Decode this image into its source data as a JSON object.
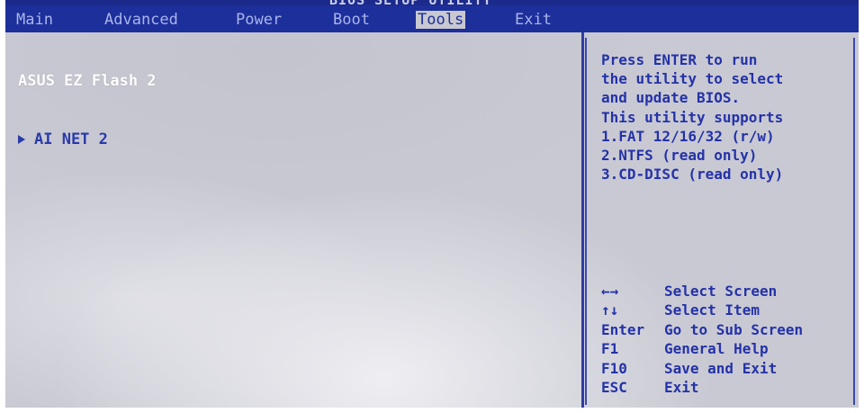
{
  "title": "BIOS SETUP UTILITY",
  "menu": [
    {
      "label": "Main"
    },
    {
      "label": "Advanced"
    },
    {
      "label": "Power"
    },
    {
      "label": "Boot"
    },
    {
      "label": "Tools"
    },
    {
      "label": "Exit"
    }
  ],
  "active_tab": "Tools",
  "left_panel": {
    "items": [
      {
        "label": "ASUS EZ Flash 2"
      },
      {
        "label": "AI NET 2",
        "icon": "right-triangle-icon"
      }
    ]
  },
  "help_panel": {
    "lines": [
      "Press ENTER to run",
      "the utility to select",
      "and update BIOS.",
      "This utility supports",
      "1.FAT 12/16/32 (r/w)",
      "2.NTFS (read only)",
      "3.CD-DISC (read only)"
    ],
    "keys": [
      {
        "key": "←→",
        "desc": "Select Screen"
      },
      {
        "key": "↑↓",
        "desc": "Select Item"
      },
      {
        "key": "Enter",
        "desc": "Go to Sub Screen"
      },
      {
        "key": "F1",
        "desc": "General Help"
      },
      {
        "key": "F10",
        "desc": "Save and Exit"
      },
      {
        "key": "ESC",
        "desc": "Exit"
      }
    ]
  },
  "colors": {
    "menubar": "#1d2f9a",
    "background": "#c9c9d3",
    "help_text": "#2432a8",
    "item_text": "#ffffff"
  }
}
